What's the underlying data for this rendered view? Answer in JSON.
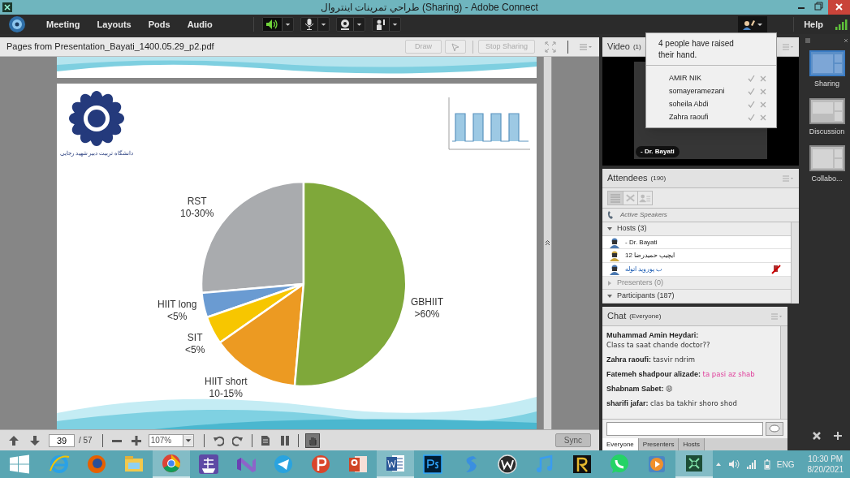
{
  "window": {
    "title": "طراحي تمرينات اينتروال (Sharing) - Adobe Connect"
  },
  "menu": [
    "Meeting",
    "Layouts",
    "Pods",
    "Audio"
  ],
  "speaker": {
    "on": true
  },
  "help": "Help",
  "share_pod": {
    "title": "Pages from Presentation_Bayati_1400.05.29_p2.pdf",
    "draw": {
      "label": "Draw",
      "disabled": true
    },
    "stop": {
      "label": "Stop Sharing",
      "disabled": true
    }
  },
  "slide": {
    "logo_text": "دانشگاه تربیت دبیر شهید رجایی",
    "slices": [
      {
        "name": "RST",
        "value": "10-30%",
        "color": "#a9abae"
      },
      {
        "name": "HIIT long",
        "value": "<5%",
        "color": "#6a9bd2"
      },
      {
        "name": "SIT",
        "value": "<5%",
        "color": "#f7c600"
      },
      {
        "name": "HIIT short",
        "value": "10-15%",
        "color": "#ec9a22"
      },
      {
        "name": "GBHIIT",
        "value": ">60%",
        "color": "#7fa83a"
      }
    ]
  },
  "page_controls": {
    "page": "39",
    "total": "/ 57",
    "zoom": "107%",
    "sync": "Sync"
  },
  "video": {
    "title": "Video",
    "count": "(1)",
    "speaker_label": "- Dr. Bayati"
  },
  "raised_hands": {
    "message": "4 people have raised their hand.",
    "people": [
      "AMIR NIK",
      "somayeramezani",
      "soheila Abdi",
      "Zahra raoufi"
    ]
  },
  "attendees": {
    "title": "Attendees",
    "count": "(190)",
    "active_speakers": "Active Speakers",
    "groups": [
      {
        "label": "Hosts (3)",
        "expanded": true,
        "children": [
          {
            "name": "- Dr. Bayati",
            "color": "#4a78b0",
            "muted": false
          },
          {
            "name": "12 ایچیپ حمیدرضا",
            "color": "#c9a33a",
            "muted": false
          },
          {
            "name": "ب پوروید اتوله",
            "color": "#4a78b0",
            "muted": true
          }
        ]
      },
      {
        "label": "Presenters (0)",
        "expanded": false
      },
      {
        "label": "Participants (187)",
        "expanded": true
      }
    ]
  },
  "chat": {
    "title": "Chat",
    "scope": "(Everyone)",
    "messages": [
      {
        "author": "Muhammad Amin Heydari:",
        "text": "Class ta saat chande doctor??",
        "highlighted": false
      },
      {
        "author": "Zahra raoufi:",
        "text": "tasvir ndrim",
        "highlighted": false
      },
      {
        "author": "Fatemeh shadpour alizade:",
        "text": "ta pasi az shab",
        "highlighted": true
      },
      {
        "author": "Shabnam Sabet:",
        "text": "😩",
        "highlighted": false
      },
      {
        "author": "sharifi jafar:",
        "text": "clas ba takhir shoro shod",
        "highlighted": false
      }
    ],
    "tabs": [
      {
        "label": "Everyone",
        "selected": true
      },
      {
        "label": "Presenters",
        "selected": false
      },
      {
        "label": "Hosts",
        "selected": false
      }
    ]
  },
  "layouts": [
    {
      "label": "Sharing",
      "selected": true
    },
    {
      "label": "Discussion",
      "selected": false
    },
    {
      "label": "Collabo...",
      "selected": false
    }
  ],
  "taskbar": {
    "apps": [
      {
        "kind": "ie",
        "active": false
      },
      {
        "kind": "firefox",
        "active": false
      },
      {
        "kind": "explorer",
        "active": false
      },
      {
        "kind": "chrome",
        "active": true
      },
      {
        "kind": "ship",
        "active": false
      },
      {
        "kind": "vs",
        "active": false
      },
      {
        "kind": "telegram",
        "active": false
      },
      {
        "kind": "psiphon",
        "active": false
      },
      {
        "kind": "powerpoint",
        "active": false
      },
      {
        "kind": "word",
        "active": true
      },
      {
        "kind": "photoshop",
        "active": false
      },
      {
        "kind": "swirl",
        "active": false
      },
      {
        "kind": "wheel",
        "active": false
      },
      {
        "kind": "music",
        "active": false
      },
      {
        "kind": "rapp",
        "active": false
      },
      {
        "kind": "whatsapp",
        "active": false
      },
      {
        "kind": "player",
        "active": false
      },
      {
        "kind": "connect",
        "active": true
      }
    ],
    "language": "ENG",
    "time": "10:30 PM",
    "date": "8/20/2021"
  }
}
